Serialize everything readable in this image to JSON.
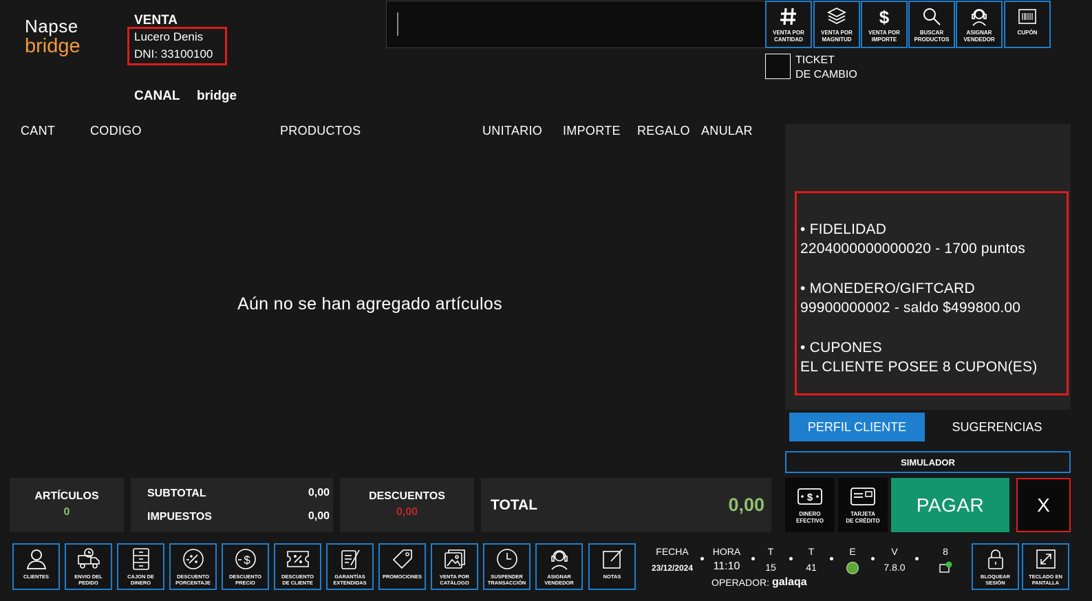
{
  "logo": {
    "line1": "Napse",
    "line2": "bridge"
  },
  "header": {
    "title": "VENTA",
    "customer_name": "Lucero Denis",
    "customer_dni": "DNI: 33100100",
    "canal_label": "CANAL",
    "canal_value": "bridge"
  },
  "toolbar": [
    {
      "label": "VENTA POR\nCANTIDAD",
      "icon": "hash-icon"
    },
    {
      "label": "VENTA POR\nMAGNITUD",
      "icon": "layers-icon"
    },
    {
      "label": "VENTA POR\nIMPORTE",
      "icon": "dollar-icon"
    },
    {
      "label": "BUSCAR\nPRODUCTOS",
      "icon": "search-icon"
    },
    {
      "label": "ASIGNAR\nVENDEDOR",
      "icon": "headset-icon"
    },
    {
      "label": "CUPÓN",
      "icon": "barcode-icon"
    }
  ],
  "ticket_cambio": "TICKET\nDE CAMBIO",
  "table": {
    "headers": [
      "CANT",
      "CODIGO",
      "PRODUCTOS",
      "UNITARIO",
      "IMPORTE",
      "REGALO",
      "ANULAR"
    ],
    "empty_message": "Aún no se han agregado artículos"
  },
  "profile": {
    "lines": [
      "• FIDELIDAD",
      "2204000000000020 - 1700 puntos",
      "• MONEDERO/GIFTCARD",
      "99900000002 - saldo $499800.00",
      "• CUPONES",
      "EL CLIENTE POSEE 8 CUPON(ES)"
    ],
    "tab_active": "PERFIL CLIENTE",
    "tab_other": "SUGERENCIAS"
  },
  "simulador": "SIMULADOR",
  "payment": {
    "cash_label": "DINERO\nEFECTIVO",
    "card_label": "TARJETA\nDE CRÉDITO",
    "pay_label": "PAGAR",
    "close_label": "X"
  },
  "totals": {
    "articulos_label": "ARTÍCULOS",
    "articulos_value": "0",
    "subtotal_label": "SUBTOTAL",
    "subtotal_value": "0,00",
    "impuestos_label": "IMPUESTOS",
    "impuestos_value": "0,00",
    "descuentos_label": "DESCUENTOS",
    "descuentos_value": "0,00",
    "total_label": "TOTAL",
    "total_value": "0,00"
  },
  "bottom_buttons": [
    {
      "label": "CLIENTES",
      "icon": "user-icon"
    },
    {
      "label": "ENVIO DEL\nPEDIDO",
      "icon": "truck-icon"
    },
    {
      "label": "CAJON DE\nDINERO",
      "icon": "drawer-icon"
    },
    {
      "label": "DESCUENTO\nPORCENTAJE",
      "icon": "percent-icon"
    },
    {
      "label": "DESCUENTO\nPRECIO",
      "icon": "price-discount-icon"
    },
    {
      "label": "DESCUENTO\nDE CLIENTE",
      "icon": "coupon-icon"
    },
    {
      "label": "GARANTÍAS\nEXTENDIDAS",
      "icon": "warranty-icon"
    },
    {
      "label": "PROMOCIONES",
      "icon": "tag-icon"
    },
    {
      "label": "VENTA POR\nCATÁLOGO",
      "icon": "catalog-icon"
    },
    {
      "label": "SUSPENDER\nTRANSACCIÓN",
      "icon": "clock-icon"
    },
    {
      "label": "ASIGNAR\nVENDEDOR",
      "icon": "headset-icon"
    },
    {
      "label": "NOTAS",
      "icon": "note-icon"
    }
  ],
  "status": {
    "fecha_label": "FECHA",
    "fecha_value": "23/12/2024",
    "hora_label": "HORA",
    "hora_value": "11:10",
    "t1_label": "T",
    "t1_value": "15",
    "t2_label": "T",
    "t2_value": "41",
    "e_label": "E",
    "v_label": "V",
    "v_value": "7.8.0",
    "n_label": "8",
    "operador_label": "OPERADOR:",
    "operador_value": "galaqa"
  },
  "right_buttons": [
    {
      "label": "BLOQUEAR\nSESIÓN",
      "icon": "lock-icon"
    },
    {
      "label": "TECLADO EN\nPANTALLA",
      "icon": "expand-icon"
    }
  ],
  "colors": {
    "accent": "#1e7fcf",
    "alert": "#e01b1b",
    "pay": "#14966d",
    "positive": "#8fbf6f",
    "negative": "#c0262c",
    "brand": "#f39a3a"
  }
}
